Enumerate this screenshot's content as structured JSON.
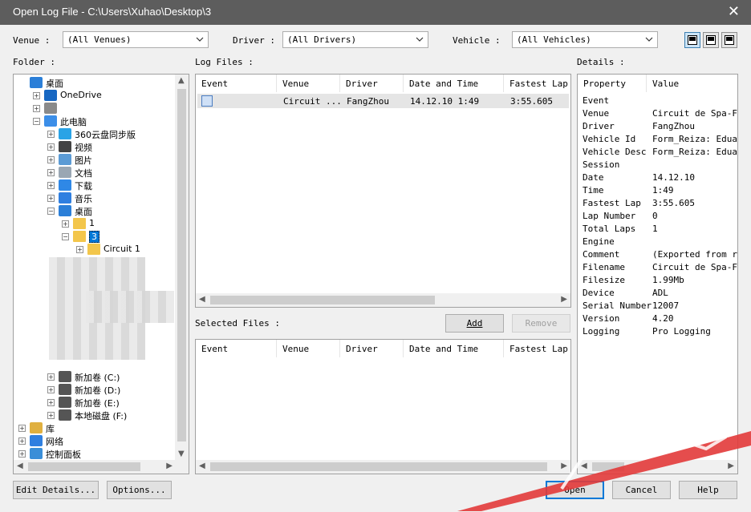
{
  "window": {
    "title": "Open Log File - C:\\Users\\Xuhao\\Desktop\\3",
    "close_glyph": "✕"
  },
  "filters": {
    "venue_label": "Venue :",
    "venue_value": "(All Venues)",
    "driver_label": "Driver :",
    "driver_value": "(All Drivers)",
    "vehicle_label": "Vehicle :",
    "vehicle_value": "(All Vehicles)"
  },
  "sections": {
    "folder": "Folder :",
    "log_files": "Log Files :",
    "details": "Details :",
    "selected_files": "Selected Files :"
  },
  "tree": [
    {
      "label": "桌面",
      "icon": "desktop-icon",
      "indent": 0,
      "exp": ""
    },
    {
      "label": "OneDrive",
      "icon": "cloud-icon",
      "indent": 1,
      "exp": "+"
    },
    {
      "label": "",
      "icon": "user-icon",
      "indent": 1,
      "exp": "+"
    },
    {
      "label": "此电脑",
      "icon": "computer-icon",
      "indent": 1,
      "exp": "−"
    },
    {
      "label": "360云盘同步版",
      "icon": "cloud-sync-icon",
      "indent": 2,
      "exp": "+"
    },
    {
      "label": "视频",
      "icon": "video-icon",
      "indent": 2,
      "exp": "+"
    },
    {
      "label": "图片",
      "icon": "picture-icon",
      "indent": 2,
      "exp": "+"
    },
    {
      "label": "文档",
      "icon": "document-icon",
      "indent": 2,
      "exp": "+"
    },
    {
      "label": "下载",
      "icon": "download-icon",
      "indent": 2,
      "exp": "+"
    },
    {
      "label": "音乐",
      "icon": "music-icon",
      "indent": 2,
      "exp": "+"
    },
    {
      "label": "桌面",
      "icon": "desktop-icon",
      "indent": 2,
      "exp": "−"
    },
    {
      "label": "1",
      "icon": "folder-icon",
      "indent": 3,
      "exp": "+"
    },
    {
      "label": "3",
      "icon": "folder-icon",
      "indent": 3,
      "exp": "−",
      "selected": true
    },
    {
      "label": "Circuit 1",
      "icon": "folder-icon",
      "indent": 4,
      "exp": "+"
    }
  ],
  "tree_bottom": [
    {
      "label": "新加卷 (C:)",
      "icon": "drive-icon",
      "indent": 2,
      "exp": "+"
    },
    {
      "label": "新加卷 (D:)",
      "icon": "drive-icon",
      "indent": 2,
      "exp": "+"
    },
    {
      "label": "新加卷 (E:)",
      "icon": "drive-icon",
      "indent": 2,
      "exp": "+"
    },
    {
      "label": "本地磁盘 (F:)",
      "icon": "drive-icon",
      "indent": 2,
      "exp": "+"
    },
    {
      "label": "库",
      "icon": "library-icon",
      "indent": 0,
      "exp": "+"
    },
    {
      "label": "网络",
      "icon": "network-icon",
      "indent": 0,
      "exp": "+"
    },
    {
      "label": "控制面板",
      "icon": "control-panel-icon",
      "indent": 0,
      "exp": "+"
    }
  ],
  "columns": [
    "Event",
    "Venue",
    "Driver",
    "Date and Time",
    "Fastest Lap"
  ],
  "log_files": [
    {
      "event": "",
      "venue": "Circuit ...",
      "driver": "FangZhou",
      "datetime": "14.12.10  1:49",
      "fastest": "3:55.605"
    }
  ],
  "buttons": {
    "add": "Add",
    "remove": "Remove",
    "edit_details": "Edit Details...",
    "options": "Options...",
    "open": "Open",
    "cancel": "Cancel",
    "help": "Help"
  },
  "details_columns": [
    "Property",
    "Value"
  ],
  "details": [
    {
      "p": "Event",
      "v": ""
    },
    {
      "p": "Venue",
      "v": "Circuit de Spa-Francorchamps"
    },
    {
      "p": "Driver",
      "v": "FangZhou"
    },
    {
      "p": "Vehicle Id",
      "v": "Form_Reiza: Eduardo"
    },
    {
      "p": "Vehicle Desc",
      "v": "Form_Reiza: Eduardo"
    },
    {
      "p": "Session",
      "v": ""
    },
    {
      "p": "Date",
      "v": "14.12.10"
    },
    {
      "p": "Time",
      "v": "1:49"
    },
    {
      "p": "Fastest Lap",
      "v": "3:55.605"
    },
    {
      "p": "Lap Number",
      "v": "0"
    },
    {
      "p": "Total Laps",
      "v": "1"
    },
    {
      "p": "Engine",
      "v": ""
    },
    {
      "p": "Comment",
      "v": "(Exported from rFactor)"
    },
    {
      "p": "Filename",
      "v": "Circuit de Spa-Francorchamps"
    },
    {
      "p": "Filesize",
      "v": "1.99Mb"
    },
    {
      "p": "Device",
      "v": "ADL"
    },
    {
      "p": "Serial Number",
      "v": "12007"
    },
    {
      "p": "Version",
      "v": "4.20"
    },
    {
      "p": "Logging",
      "v": "Pro Logging"
    }
  ],
  "colors": {
    "titlebar": "#5d5d5d",
    "selection": "#0078d7",
    "watermark": "#e23a3a"
  }
}
